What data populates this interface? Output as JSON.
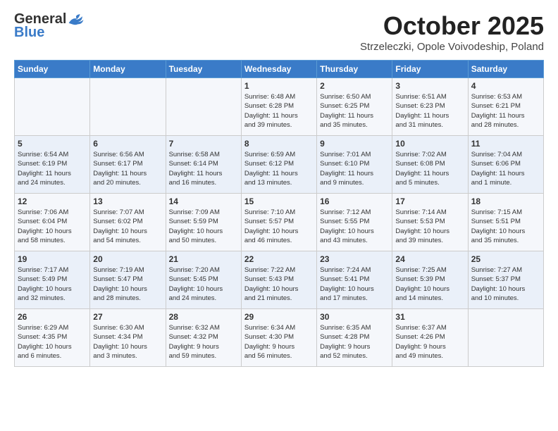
{
  "header": {
    "logo_general": "General",
    "logo_blue": "Blue",
    "month": "October 2025",
    "location": "Strzeleczki, Opole Voivodeship, Poland"
  },
  "days_of_week": [
    "Sunday",
    "Monday",
    "Tuesday",
    "Wednesday",
    "Thursday",
    "Friday",
    "Saturday"
  ],
  "weeks": [
    [
      {
        "day": "",
        "info": ""
      },
      {
        "day": "",
        "info": ""
      },
      {
        "day": "",
        "info": ""
      },
      {
        "day": "1",
        "info": "Sunrise: 6:48 AM\nSunset: 6:28 PM\nDaylight: 11 hours\nand 39 minutes."
      },
      {
        "day": "2",
        "info": "Sunrise: 6:50 AM\nSunset: 6:25 PM\nDaylight: 11 hours\nand 35 minutes."
      },
      {
        "day": "3",
        "info": "Sunrise: 6:51 AM\nSunset: 6:23 PM\nDaylight: 11 hours\nand 31 minutes."
      },
      {
        "day": "4",
        "info": "Sunrise: 6:53 AM\nSunset: 6:21 PM\nDaylight: 11 hours\nand 28 minutes."
      }
    ],
    [
      {
        "day": "5",
        "info": "Sunrise: 6:54 AM\nSunset: 6:19 PM\nDaylight: 11 hours\nand 24 minutes."
      },
      {
        "day": "6",
        "info": "Sunrise: 6:56 AM\nSunset: 6:17 PM\nDaylight: 11 hours\nand 20 minutes."
      },
      {
        "day": "7",
        "info": "Sunrise: 6:58 AM\nSunset: 6:14 PM\nDaylight: 11 hours\nand 16 minutes."
      },
      {
        "day": "8",
        "info": "Sunrise: 6:59 AM\nSunset: 6:12 PM\nDaylight: 11 hours\nand 13 minutes."
      },
      {
        "day": "9",
        "info": "Sunrise: 7:01 AM\nSunset: 6:10 PM\nDaylight: 11 hours\nand 9 minutes."
      },
      {
        "day": "10",
        "info": "Sunrise: 7:02 AM\nSunset: 6:08 PM\nDaylight: 11 hours\nand 5 minutes."
      },
      {
        "day": "11",
        "info": "Sunrise: 7:04 AM\nSunset: 6:06 PM\nDaylight: 11 hours\nand 1 minute."
      }
    ],
    [
      {
        "day": "12",
        "info": "Sunrise: 7:06 AM\nSunset: 6:04 PM\nDaylight: 10 hours\nand 58 minutes."
      },
      {
        "day": "13",
        "info": "Sunrise: 7:07 AM\nSunset: 6:02 PM\nDaylight: 10 hours\nand 54 minutes."
      },
      {
        "day": "14",
        "info": "Sunrise: 7:09 AM\nSunset: 5:59 PM\nDaylight: 10 hours\nand 50 minutes."
      },
      {
        "day": "15",
        "info": "Sunrise: 7:10 AM\nSunset: 5:57 PM\nDaylight: 10 hours\nand 46 minutes."
      },
      {
        "day": "16",
        "info": "Sunrise: 7:12 AM\nSunset: 5:55 PM\nDaylight: 10 hours\nand 43 minutes."
      },
      {
        "day": "17",
        "info": "Sunrise: 7:14 AM\nSunset: 5:53 PM\nDaylight: 10 hours\nand 39 minutes."
      },
      {
        "day": "18",
        "info": "Sunrise: 7:15 AM\nSunset: 5:51 PM\nDaylight: 10 hours\nand 35 minutes."
      }
    ],
    [
      {
        "day": "19",
        "info": "Sunrise: 7:17 AM\nSunset: 5:49 PM\nDaylight: 10 hours\nand 32 minutes."
      },
      {
        "day": "20",
        "info": "Sunrise: 7:19 AM\nSunset: 5:47 PM\nDaylight: 10 hours\nand 28 minutes."
      },
      {
        "day": "21",
        "info": "Sunrise: 7:20 AM\nSunset: 5:45 PM\nDaylight: 10 hours\nand 24 minutes."
      },
      {
        "day": "22",
        "info": "Sunrise: 7:22 AM\nSunset: 5:43 PM\nDaylight: 10 hours\nand 21 minutes."
      },
      {
        "day": "23",
        "info": "Sunrise: 7:24 AM\nSunset: 5:41 PM\nDaylight: 10 hours\nand 17 minutes."
      },
      {
        "day": "24",
        "info": "Sunrise: 7:25 AM\nSunset: 5:39 PM\nDaylight: 10 hours\nand 14 minutes."
      },
      {
        "day": "25",
        "info": "Sunrise: 7:27 AM\nSunset: 5:37 PM\nDaylight: 10 hours\nand 10 minutes."
      }
    ],
    [
      {
        "day": "26",
        "info": "Sunrise: 6:29 AM\nSunset: 4:35 PM\nDaylight: 10 hours\nand 6 minutes."
      },
      {
        "day": "27",
        "info": "Sunrise: 6:30 AM\nSunset: 4:34 PM\nDaylight: 10 hours\nand 3 minutes."
      },
      {
        "day": "28",
        "info": "Sunrise: 6:32 AM\nSunset: 4:32 PM\nDaylight: 9 hours\nand 59 minutes."
      },
      {
        "day": "29",
        "info": "Sunrise: 6:34 AM\nSunset: 4:30 PM\nDaylight: 9 hours\nand 56 minutes."
      },
      {
        "day": "30",
        "info": "Sunrise: 6:35 AM\nSunset: 4:28 PM\nDaylight: 9 hours\nand 52 minutes."
      },
      {
        "day": "31",
        "info": "Sunrise: 6:37 AM\nSunset: 4:26 PM\nDaylight: 9 hours\nand 49 minutes."
      },
      {
        "day": "",
        "info": ""
      }
    ]
  ]
}
